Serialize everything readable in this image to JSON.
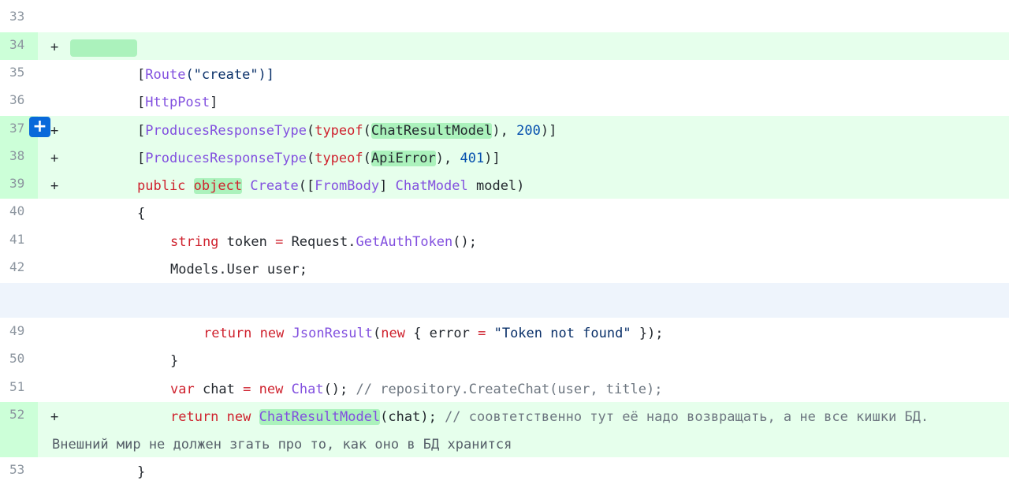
{
  "lines": {
    "l33": {
      "num": "33"
    },
    "l34": {
      "num": "34",
      "sign": "+"
    },
    "l35": {
      "num": "35",
      "t1": "[",
      "t2": "Route",
      "t3": "(\"create\")]"
    },
    "l36": {
      "num": "36",
      "t1": "[",
      "t2": "HttpPost",
      "t3": "]"
    },
    "l37": {
      "num": "37",
      "sign": "+",
      "t1": "[",
      "t2": "ProducesResponseType",
      "t3": "(",
      "t4": "typeof",
      "t5": "(",
      "t6": "ChatResultModel",
      "t7": "), ",
      "t8": "200",
      "t9": ")]"
    },
    "l38": {
      "num": "38",
      "sign": "+",
      "t1": "[",
      "t2": "ProducesResponseType",
      "t3": "(",
      "t4": "typeof",
      "t5": "(",
      "t6": "ApiError",
      "t7": "), ",
      "t8": "401",
      "t9": ")]"
    },
    "l39": {
      "num": "39",
      "sign": "+",
      "t1": "public",
      "t2": " ",
      "t3": "object",
      "t4": " ",
      "t5": "Create",
      "t6": "([",
      "t7": "FromBody",
      "t8": "] ",
      "t9": "ChatModel",
      "t10": " model)"
    },
    "l40": {
      "num": "40",
      "t1": "{"
    },
    "l41": {
      "num": "41",
      "t1": "string",
      "t2": " token ",
      "t3": "=",
      "t4": " Request.",
      "t5": "GetAuthToken",
      "t6": "();"
    },
    "l42": {
      "num": "42",
      "t1": "Models.User user;"
    },
    "l49": {
      "num": "49",
      "t1": "return",
      "t2": " ",
      "t3": "new",
      "t4": " ",
      "t5": "JsonResult",
      "t6": "(",
      "t7": "new",
      "t8": " { error ",
      "t9": "=",
      "t10": " ",
      "t11": "\"Token not found\"",
      "t12": " });"
    },
    "l50": {
      "num": "50",
      "t1": "}"
    },
    "l51": {
      "num": "51",
      "t1": "var",
      "t2": " chat ",
      "t3": "=",
      "t4": " ",
      "t5": "new",
      "t6": " ",
      "t7": "Chat",
      "t8": "(); ",
      "t9": "// repository.CreateChat(user, title);"
    },
    "l52": {
      "num": "52",
      "sign": "+",
      "t1": "return",
      "t2": " ",
      "t3": "new",
      "t4": " ",
      "t5": "ChatResultModel",
      "t6": "(chat); ",
      "t7": "// соовтетственно тут её надо возвращать, а не все кишки БД.",
      "t8": "Внешний мир не должен згать про то, как оно в БД хранится"
    },
    "l53": {
      "num": "53",
      "t1": "}"
    }
  },
  "add_comment_label": "+"
}
